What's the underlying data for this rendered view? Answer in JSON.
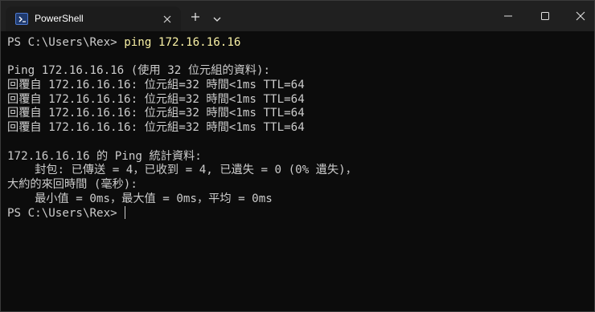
{
  "window": {
    "tab_title": "PowerShell",
    "tab_icon": "powershell-icon",
    "controls": [
      "minimize-icon",
      "maximize-icon",
      "close-icon"
    ]
  },
  "terminal": {
    "prompt_1": "PS C:\\Users\\Rex> ",
    "command": "ping 172.16.16.16",
    "blank_1": "",
    "header": "Ping 172.16.16.16 (使用 32 位元組的資料):",
    "replies": [
      "回覆自 172.16.16.16: 位元組=32 時間<1ms TTL=64",
      "回覆自 172.16.16.16: 位元組=32 時間<1ms TTL=64",
      "回覆自 172.16.16.16: 位元組=32 時間<1ms TTL=64",
      "回覆自 172.16.16.16: 位元組=32 時間<1ms TTL=64"
    ],
    "blank_2": "",
    "stats_title": "172.16.16.16 的 Ping 統計資料:",
    "packets": "    封包: 已傳送 = 4，已收到 = 4, 已遺失 = 0 (0% 遺失)，",
    "rtt_title": "大約的來回時間 (毫秒):",
    "rtt_values": "    最小值 = 0ms，最大值 = 0ms，平均 = 0ms",
    "prompt_2": "PS C:\\Users\\Rex> "
  }
}
